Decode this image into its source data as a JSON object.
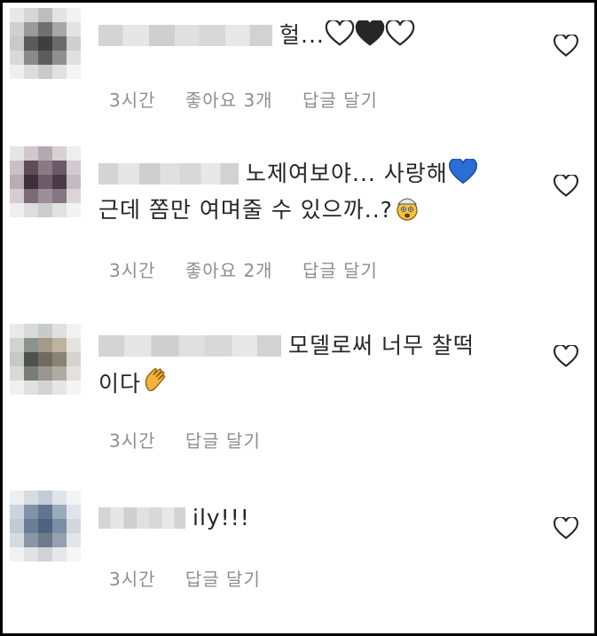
{
  "comments": [
    {
      "text": "헐...",
      "trailing_icons": [
        "white-heart-icon",
        "black-heart-icon",
        "white-heart-icon"
      ],
      "meta": {
        "time": "3시간",
        "likes": "좋아요 3개",
        "reply": "답글 달기"
      }
    },
    {
      "text_line1": "노제여보야... 사랑해",
      "text_line2": "근데 쫌만 여며줄 수 있으까..?",
      "icons": [
        "blue-heart-icon",
        "exploding-head-icon"
      ],
      "meta": {
        "time": "3시간",
        "likes": "좋아요 2개",
        "reply": "답글 달기"
      }
    },
    {
      "text_line1": "모델로써 너무 찰떡",
      "text_line2": "이다",
      "icons": [
        "clapping-hands-icon"
      ],
      "meta": {
        "time": "3시간",
        "reply": "답글 달기"
      }
    },
    {
      "text": "ily!!!",
      "meta": {
        "time": "3시간",
        "reply": "답글 달기"
      }
    }
  ],
  "colors": {
    "text": "#262626",
    "meta": "#8e8e8e",
    "blue_heart": "#2a6fd6"
  }
}
